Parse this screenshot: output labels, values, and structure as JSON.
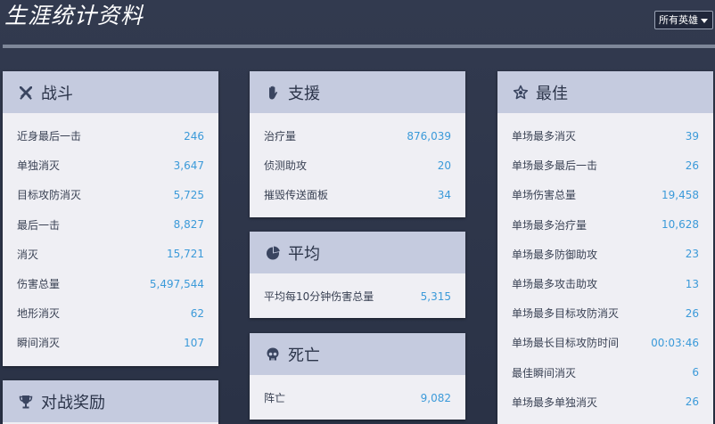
{
  "page": {
    "title": "生涯统计资料",
    "hero_filter": "所有英雄"
  },
  "colors": {
    "background": "#2b3347",
    "card_header": "#c5cbdf",
    "card_body": "#efeff4",
    "value": "#3b9ad9"
  },
  "combat": {
    "title": "战斗",
    "icon": "crossed-swords-icon",
    "rows": [
      {
        "label": "近身最后一击",
        "value": "246"
      },
      {
        "label": "单独消灭",
        "value": "3,647"
      },
      {
        "label": "目标攻防消灭",
        "value": "5,725"
      },
      {
        "label": "最后一击",
        "value": "8,827"
      },
      {
        "label": "消灭",
        "value": "15,721"
      },
      {
        "label": "伤害总量",
        "value": "5,497,544"
      },
      {
        "label": "地形消灭",
        "value": "62"
      },
      {
        "label": "瞬间消灭",
        "value": "107"
      }
    ]
  },
  "match_awards": {
    "title": "对战奖励",
    "icon": "trophy-icon"
  },
  "assists": {
    "title": "支援",
    "icon": "hand-icon",
    "rows": [
      {
        "label": "治疗量",
        "value": "876,039"
      },
      {
        "label": "侦测助攻",
        "value": "20"
      },
      {
        "label": "摧毁传送面板",
        "value": "34"
      }
    ]
  },
  "average": {
    "title": "平均",
    "icon": "pie-chart-icon",
    "rows": [
      {
        "label": "平均每10分钟伤害总量",
        "value": "5,315"
      }
    ]
  },
  "deaths": {
    "title": "死亡",
    "icon": "skull-icon",
    "rows": [
      {
        "label": "阵亡",
        "value": "9,082"
      }
    ]
  },
  "best": {
    "title": "最佳",
    "icon": "star-badge-icon",
    "rows": [
      {
        "label": "单场最多消灭",
        "value": "39"
      },
      {
        "label": "单场最多最后一击",
        "value": "26"
      },
      {
        "label": "单场伤害总量",
        "value": "19,458"
      },
      {
        "label": "单场最多治疗量",
        "value": "10,628"
      },
      {
        "label": "单场最多防御助攻",
        "value": "23"
      },
      {
        "label": "单场最多攻击助攻",
        "value": "13"
      },
      {
        "label": "单场最多目标攻防消灭",
        "value": "26"
      },
      {
        "label": "单场最长目标攻防时间",
        "value": "00:03:46"
      },
      {
        "label": "最佳瞬间消灭",
        "value": "6"
      },
      {
        "label": "单场最多单独消灭",
        "value": "26"
      }
    ]
  }
}
